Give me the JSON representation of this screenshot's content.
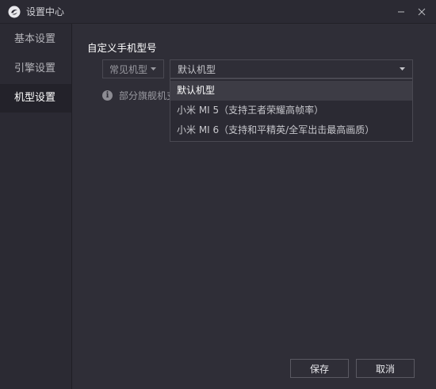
{
  "window": {
    "title": "设置中心",
    "minimize_icon": "minimize-icon",
    "close_icon": "close-icon"
  },
  "sidebar": {
    "items": [
      {
        "label": "基本设置",
        "active": false
      },
      {
        "label": "引擎设置",
        "active": false
      },
      {
        "label": "机型设置",
        "active": true
      }
    ]
  },
  "main": {
    "section_title": "自定义手机型号",
    "common_select": {
      "value": "常见机型",
      "icon": "chevron-down-icon"
    },
    "model_select": {
      "value": "默认机型",
      "icon": "chevron-down-icon"
    },
    "info_text": "部分旗舰机支",
    "dropdown": {
      "options": [
        "默认机型",
        "小米 MI 5（支持王者荣耀高帧率）",
        "小米 MI 6（支持和平精英/全军出击最高画质）"
      ],
      "highlighted_index": 0
    }
  },
  "footer": {
    "save_label": "保存",
    "cancel_label": "取消"
  },
  "colors": {
    "background": "#2f2e37",
    "sidebar_bg": "#2b2a33",
    "active_item_bg": "#23222a",
    "border": "#4a4952"
  }
}
